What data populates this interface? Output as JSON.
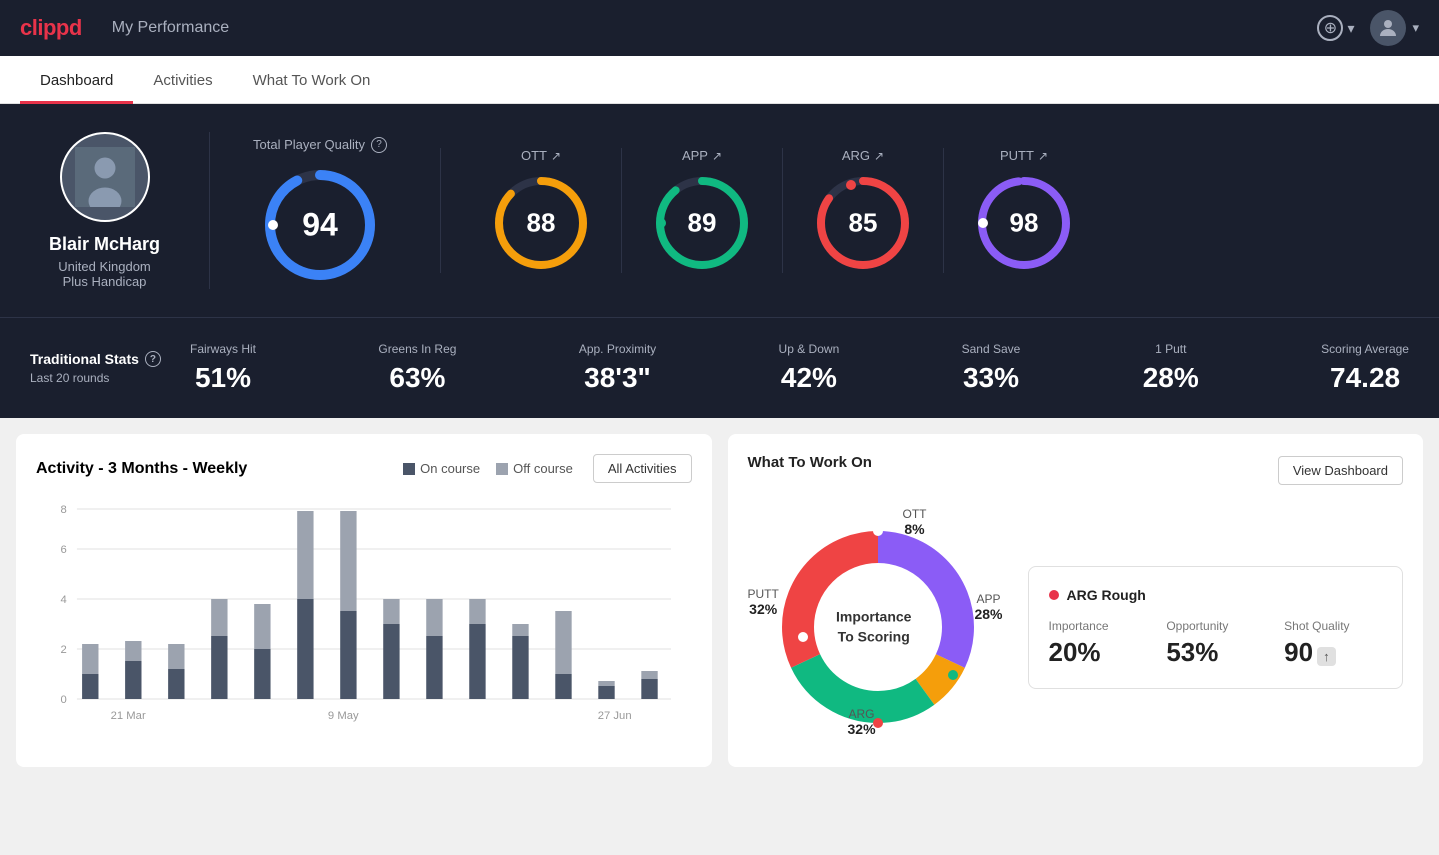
{
  "header": {
    "logo": "clippd",
    "title": "My Performance",
    "add_label": "",
    "chevron": "▾"
  },
  "nav": {
    "tabs": [
      "Dashboard",
      "Activities",
      "What To Work On"
    ],
    "active": 0
  },
  "player": {
    "name": "Blair McHarg",
    "location": "United Kingdom",
    "handicap": "Plus Handicap"
  },
  "total_quality": {
    "label": "Total Player Quality",
    "value": "94",
    "color": "#3b82f6",
    "bg_color": "#1a1f2e"
  },
  "scores": [
    {
      "label": "OTT",
      "value": "88",
      "color": "#f59e0b",
      "trend": "↗"
    },
    {
      "label": "APP",
      "value": "89",
      "color": "#10b981",
      "trend": "↗"
    },
    {
      "label": "ARG",
      "value": "85",
      "color": "#ef4444",
      "trend": "↗"
    },
    {
      "label": "PUTT",
      "value": "98",
      "color": "#8b5cf6",
      "trend": "↗"
    }
  ],
  "traditional_stats": {
    "label": "Traditional Stats",
    "period": "Last 20 rounds",
    "stats": [
      {
        "label": "Fairways Hit",
        "value": "51%"
      },
      {
        "label": "Greens In Reg",
        "value": "63%"
      },
      {
        "label": "App. Proximity",
        "value": "38'3\""
      },
      {
        "label": "Up & Down",
        "value": "42%"
      },
      {
        "label": "Sand Save",
        "value": "33%"
      },
      {
        "label": "1 Putt",
        "value": "28%"
      },
      {
        "label": "Scoring Average",
        "value": "74.28"
      }
    ]
  },
  "activity_chart": {
    "title": "Activity - 3 Months - Weekly",
    "legend": [
      "On course",
      "Off course"
    ],
    "all_activities_btn": "All Activities",
    "x_labels": [
      "21 Mar",
      "9 May",
      "27 Jun"
    ],
    "y_labels": [
      "0",
      "2",
      "4",
      "6",
      "8"
    ],
    "bars": [
      {
        "on": 1,
        "off": 1.2
      },
      {
        "on": 1.5,
        "off": 0.8
      },
      {
        "on": 1.2,
        "off": 1
      },
      {
        "on": 2.5,
        "off": 1.5
      },
      {
        "on": 2,
        "off": 1.8
      },
      {
        "on": 4,
        "off": 4.5
      },
      {
        "on": 3.5,
        "off": 4
      },
      {
        "on": 3,
        "off": 1
      },
      {
        "on": 2.5,
        "off": 1.5
      },
      {
        "on": 3,
        "off": 1
      },
      {
        "on": 2.5,
        "off": 0.5
      },
      {
        "on": 1,
        "off": 2.5
      },
      {
        "on": 0.5,
        "off": 0.2
      },
      {
        "on": 0.8,
        "off": 0.3
      }
    ]
  },
  "what_to_work_on": {
    "title": "What To Work On",
    "view_dashboard_btn": "View Dashboard",
    "center_text": "Importance\nTo Scoring",
    "segments": [
      {
        "label": "OTT",
        "value": "8%",
        "color": "#f59e0b"
      },
      {
        "label": "APP",
        "value": "28%",
        "color": "#10b981"
      },
      {
        "label": "ARG",
        "value": "32%",
        "color": "#ef4444"
      },
      {
        "label": "PUTT",
        "value": "32%",
        "color": "#8b5cf6"
      }
    ],
    "info_card": {
      "title": "ARG Rough",
      "dot_color": "#ef4444",
      "stats": [
        {
          "label": "Importance",
          "value": "20%"
        },
        {
          "label": "Opportunity",
          "value": "53%"
        },
        {
          "label": "Shot Quality",
          "value": "90",
          "badge": ""
        }
      ]
    }
  }
}
